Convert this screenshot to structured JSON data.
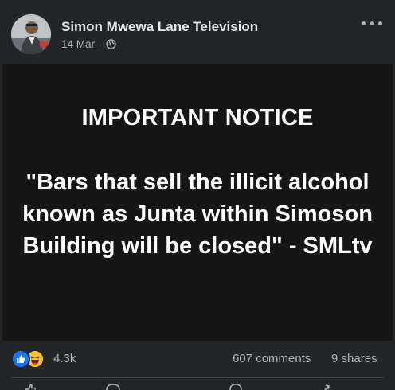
{
  "post": {
    "author": "Simon Mwewa Lane Television",
    "date": "14 Mar",
    "separator": "·",
    "audience_icon": "globe-icon",
    "menu_icon": "more-options-icon"
  },
  "notice": {
    "title": "IMPORTANT NOTICE",
    "quote": "\"Bars that sell the illicit alcohol known as Junta within Simoson Building will be closed\" - SMLtv"
  },
  "engagement": {
    "reaction_icons": [
      "like-icon",
      "haha-icon"
    ],
    "reactions": "4.3k",
    "comments": "607 comments",
    "shares": "9 shares"
  },
  "actions": [
    "like-icon",
    "comment-icon",
    "send-icon",
    "share-icon"
  ],
  "colors": {
    "background": "#242526",
    "image_background": "#161616",
    "text_primary": "#e4e6eb",
    "text_secondary": "#b0b3b8",
    "like_blue": "#1877f2",
    "haha_yellow": "#f7c233"
  }
}
